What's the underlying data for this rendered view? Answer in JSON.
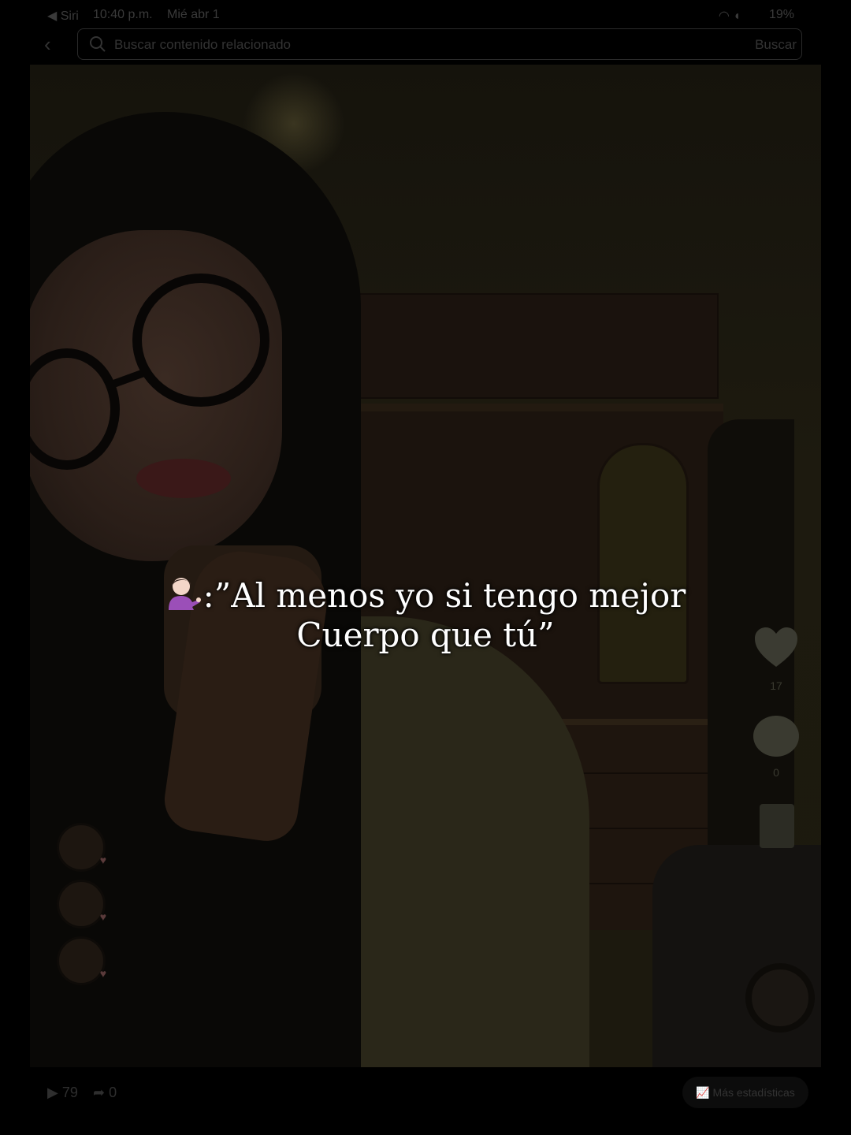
{
  "status_bar": {
    "back_app": "◀ Siri",
    "time": "10:40 p.m.",
    "date": "Mié abr 1",
    "battery": "19%"
  },
  "search": {
    "placeholder": "Buscar contenido relacionado",
    "button_label": "Buscar"
  },
  "video": {
    "caption_line1": ":”Al menos yo si tengo mejor",
    "caption_line2": "Cuerpo que tú”",
    "caption_emoji": "person-tipping-hand-emoji",
    "likes": "17",
    "comments": "0"
  },
  "bottom": {
    "views": "79",
    "shares": "0",
    "stats_label": "Más estadísticas"
  },
  "icons": [
    "back-icon",
    "search-icon",
    "play-icon",
    "share-icon",
    "chart-icon",
    "heart-icon",
    "comment-icon",
    "bookmark-icon"
  ]
}
